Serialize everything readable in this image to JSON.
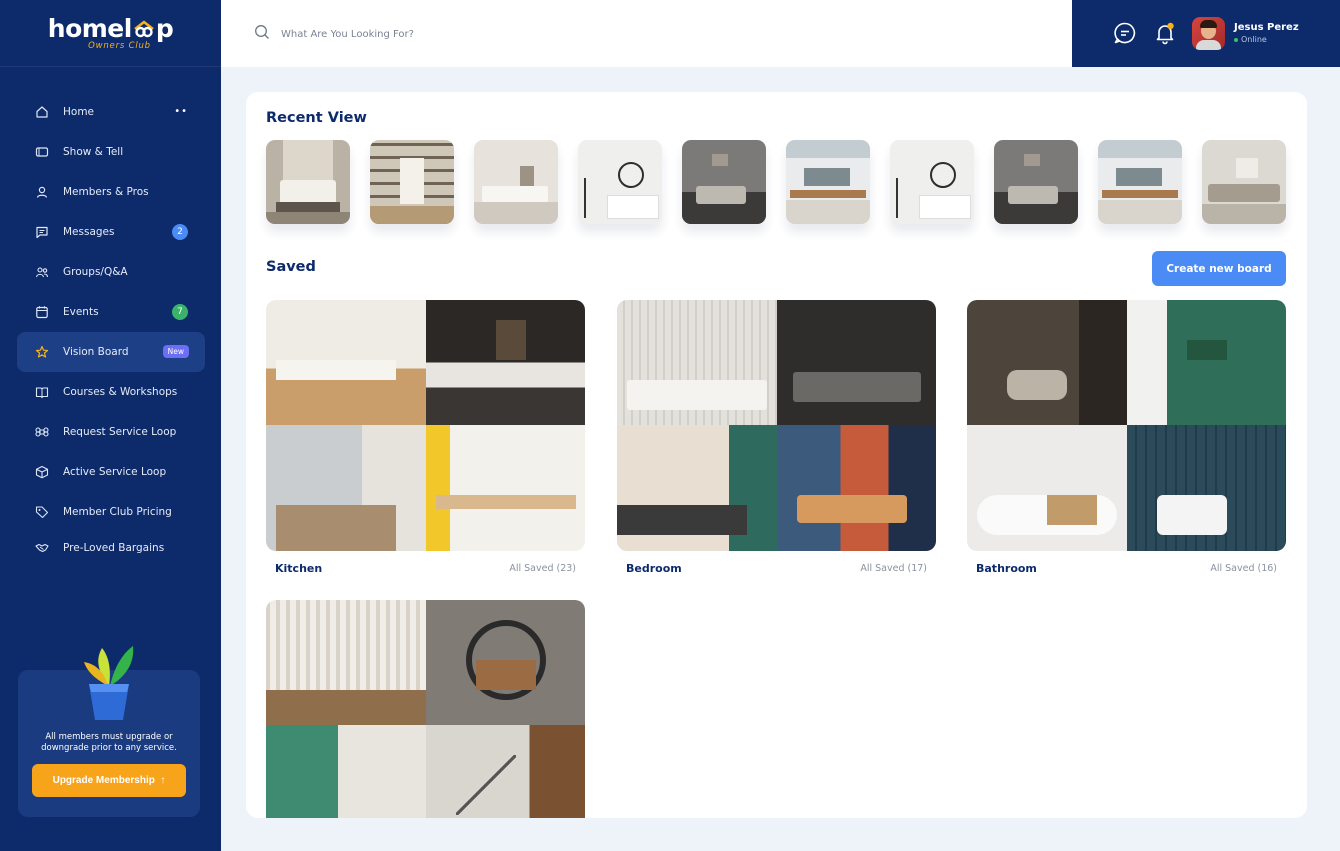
{
  "brand": {
    "name_left": "homel",
    "name_right": "p",
    "tagline": "Owners Club",
    "accent": "#f6b21a"
  },
  "colors": {
    "sidebar": "#0d2a6b",
    "primary_button": "#4a8bf5",
    "upgrade_button": "#f8a41b"
  },
  "search": {
    "placeholder": "What Are You Looking For?",
    "icon": "search-icon"
  },
  "user": {
    "name": "Jesus Perez",
    "status": "Online"
  },
  "sidebar": {
    "items": [
      {
        "label": "Home",
        "icon": "home-icon"
      },
      {
        "label": "Show & Tell",
        "icon": "tv-icon"
      },
      {
        "label": "Members & Pros",
        "icon": "user-icon"
      },
      {
        "label": "Messages",
        "icon": "message-icon",
        "badge": "2"
      },
      {
        "label": "Groups/Q&A",
        "icon": "group-icon"
      },
      {
        "label": "Events",
        "icon": "calendar-icon",
        "badge": "7"
      },
      {
        "label": "Vision Board",
        "icon": "star-icon",
        "pill": "New"
      },
      {
        "label": "Courses & Workshops",
        "icon": "book-icon"
      },
      {
        "label": "Request Service Loop",
        "icon": "command-icon"
      },
      {
        "label": "Active Service Loop",
        "icon": "box-icon"
      },
      {
        "label": "Member Club Pricing",
        "icon": "tag-icon"
      },
      {
        "label": "Pre-Loved Bargains",
        "icon": "handshake-icon"
      }
    ]
  },
  "promo": {
    "text": "All members must upgrade or downgrade prior to any service.",
    "button": "Upgrade Membership",
    "button_arrow": "↑"
  },
  "main": {
    "recent_title": "Recent View",
    "saved_title": "Saved",
    "create_button": "Create new board",
    "boards": [
      {
        "name": "Kitchen",
        "count": "All Saved (23)"
      },
      {
        "name": "Bedroom",
        "count": "All Saved (17)"
      },
      {
        "name": "Bathroom",
        "count": "All Saved (16)"
      },
      {
        "name": "",
        "count": ""
      }
    ]
  }
}
